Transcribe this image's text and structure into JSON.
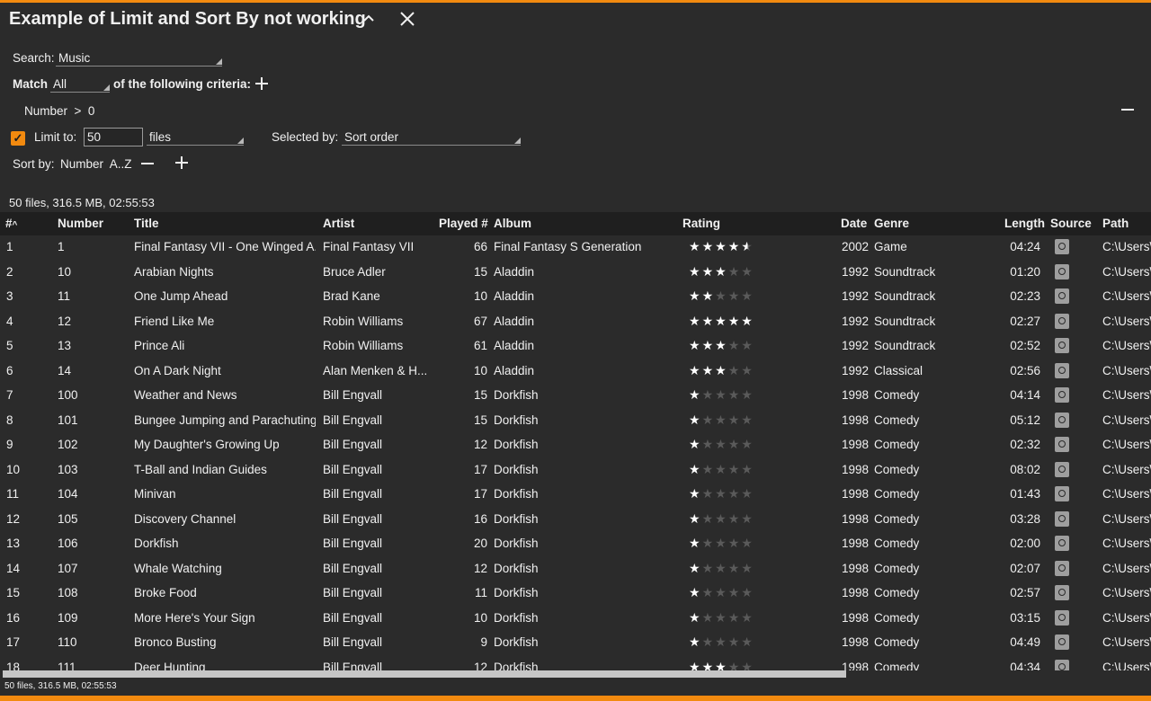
{
  "window": {
    "title": "Example of Limit and Sort By not working",
    "collapse_icon": "chevron-up-icon",
    "close_icon": "close-icon"
  },
  "accent_color": "#f28a0f",
  "search": {
    "label": "Search:",
    "value": "Music"
  },
  "match": {
    "label": "Match",
    "value": "All",
    "suffix": "of the following criteria:"
  },
  "criteria": [
    {
      "text": "Number  >  0"
    }
  ],
  "limit": {
    "checked": true,
    "label": "Limit to:",
    "value": "50",
    "unit": "files",
    "selected_by_label": "Selected by:",
    "selected_by_value": "Sort order"
  },
  "sort": {
    "label": "Sort by:",
    "value": "Number  A..Z"
  },
  "status": "50 files, 316.5 MB, 02:55:53",
  "columns": {
    "index": "#",
    "number": "Number",
    "title": "Title",
    "artist": "Artist",
    "played": "Played #",
    "album": "Album",
    "rating": "Rating",
    "date": "Date",
    "genre": "Genre",
    "length": "Length",
    "source": "Source",
    "path": "Path"
  },
  "rows": [
    {
      "idx": "1",
      "number": "1",
      "title": "Final Fantasy VII - One Winged A...",
      "artist": "Final Fantasy VII",
      "played": "66",
      "album": "Final Fantasy S Generation",
      "rating": 4.5,
      "date": "2002",
      "genre": "Game",
      "length": "04:24",
      "path": "C:\\Users\\"
    },
    {
      "idx": "2",
      "number": "10",
      "title": "Arabian Nights",
      "artist": "Bruce Adler",
      "played": "15",
      "album": "Aladdin",
      "rating": 3,
      "date": "1992",
      "genre": "Soundtrack",
      "length": "01:20",
      "path": "C:\\Users\\"
    },
    {
      "idx": "3",
      "number": "11",
      "title": "One Jump Ahead",
      "artist": "Brad Kane",
      "played": "10",
      "album": "Aladdin",
      "rating": 2,
      "date": "1992",
      "genre": "Soundtrack",
      "length": "02:23",
      "path": "C:\\Users\\"
    },
    {
      "idx": "4",
      "number": "12",
      "title": "Friend Like Me",
      "artist": "Robin Williams",
      "played": "67",
      "album": "Aladdin",
      "rating": 5,
      "date": "1992",
      "genre": "Soundtrack",
      "length": "02:27",
      "path": "C:\\Users\\"
    },
    {
      "idx": "5",
      "number": "13",
      "title": "Prince Ali",
      "artist": "Robin Williams",
      "played": "61",
      "album": "Aladdin",
      "rating": 3,
      "date": "1992",
      "genre": "Soundtrack",
      "length": "02:52",
      "path": "C:\\Users\\"
    },
    {
      "idx": "6",
      "number": "14",
      "title": "On A Dark Night",
      "artist": "Alan Menken & H...",
      "played": "10",
      "album": "Aladdin",
      "rating": 3,
      "date": "1992",
      "genre": "Classical",
      "length": "02:56",
      "path": "C:\\Users\\"
    },
    {
      "idx": "7",
      "number": "100",
      "title": "Weather and News",
      "artist": "Bill Engvall",
      "played": "15",
      "album": "Dorkfish",
      "rating": 1,
      "date": "1998",
      "genre": "Comedy",
      "length": "04:14",
      "path": "C:\\Users\\"
    },
    {
      "idx": "8",
      "number": "101",
      "title": "Bungee Jumping and Parachuting",
      "artist": "Bill Engvall",
      "played": "15",
      "album": "Dorkfish",
      "rating": 1,
      "date": "1998",
      "genre": "Comedy",
      "length": "05:12",
      "path": "C:\\Users\\"
    },
    {
      "idx": "9",
      "number": "102",
      "title": "My Daughter's Growing Up",
      "artist": "Bill Engvall",
      "played": "12",
      "album": "Dorkfish",
      "rating": 1,
      "date": "1998",
      "genre": "Comedy",
      "length": "02:32",
      "path": "C:\\Users\\"
    },
    {
      "idx": "10",
      "number": "103",
      "title": "T-Ball and Indian Guides",
      "artist": "Bill Engvall",
      "played": "17",
      "album": "Dorkfish",
      "rating": 1,
      "date": "1998",
      "genre": "Comedy",
      "length": "08:02",
      "path": "C:\\Users\\"
    },
    {
      "idx": "11",
      "number": "104",
      "title": "Minivan",
      "artist": "Bill Engvall",
      "played": "17",
      "album": "Dorkfish",
      "rating": 1,
      "date": "1998",
      "genre": "Comedy",
      "length": "01:43",
      "path": "C:\\Users\\"
    },
    {
      "idx": "12",
      "number": "105",
      "title": "Discovery Channel",
      "artist": "Bill Engvall",
      "played": "16",
      "album": "Dorkfish",
      "rating": 1,
      "date": "1998",
      "genre": "Comedy",
      "length": "03:28",
      "path": "C:\\Users\\"
    },
    {
      "idx": "13",
      "number": "106",
      "title": "Dorkfish",
      "artist": "Bill Engvall",
      "played": "20",
      "album": "Dorkfish",
      "rating": 1,
      "date": "1998",
      "genre": "Comedy",
      "length": "02:00",
      "path": "C:\\Users\\"
    },
    {
      "idx": "14",
      "number": "107",
      "title": "Whale Watching",
      "artist": "Bill Engvall",
      "played": "12",
      "album": "Dorkfish",
      "rating": 1,
      "date": "1998",
      "genre": "Comedy",
      "length": "02:07",
      "path": "C:\\Users\\"
    },
    {
      "idx": "15",
      "number": "108",
      "title": "Broke Food",
      "artist": "Bill Engvall",
      "played": "11",
      "album": "Dorkfish",
      "rating": 1,
      "date": "1998",
      "genre": "Comedy",
      "length": "02:57",
      "path": "C:\\Users\\"
    },
    {
      "idx": "16",
      "number": "109",
      "title": "More Here's Your Sign",
      "artist": "Bill Engvall",
      "played": "10",
      "album": "Dorkfish",
      "rating": 1,
      "date": "1998",
      "genre": "Comedy",
      "length": "03:15",
      "path": "C:\\Users\\"
    },
    {
      "idx": "17",
      "number": "110",
      "title": "Bronco Busting",
      "artist": "Bill Engvall",
      "played": "9",
      "album": "Dorkfish",
      "rating": 1,
      "date": "1998",
      "genre": "Comedy",
      "length": "04:49",
      "path": "C:\\Users\\"
    },
    {
      "idx": "18",
      "number": "111",
      "title": "Deer Hunting",
      "artist": "Bill Engvall",
      "played": "12",
      "album": "Dorkfish",
      "rating": 3,
      "date": "1998",
      "genre": "Comedy",
      "length": "04:34",
      "path": "C:\\Users\\"
    }
  ]
}
